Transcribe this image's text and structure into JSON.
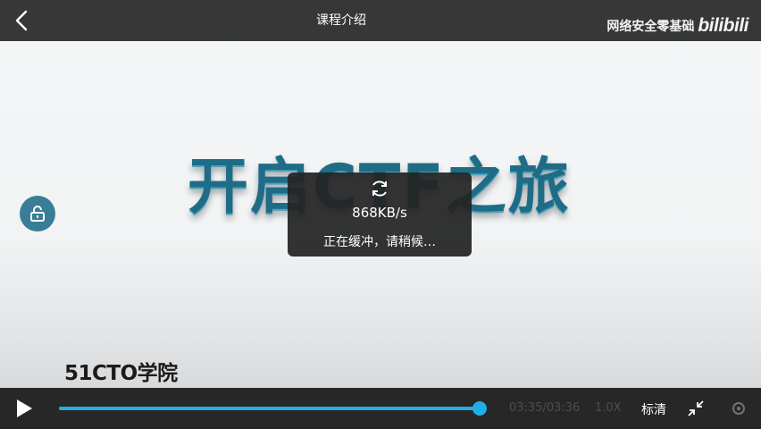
{
  "header": {
    "title": "课程介绍",
    "back_icon": "chevron-left-icon"
  },
  "watermark": {
    "uploader": "网络安全零基础",
    "logo_text": "bilibili"
  },
  "slide": {
    "title": "开启CTF之旅",
    "footer_logo": "51CTO学院"
  },
  "lock": {
    "icon": "unlock-icon"
  },
  "buffering": {
    "icon": "refresh-icon",
    "speed": "868KB/s",
    "message": "正在缓冲，请稍候…"
  },
  "controls": {
    "play_icon": "play-icon",
    "time": "03:35/03:36",
    "speed": "1.0X",
    "quality": "标清",
    "exit_fullscreen_icon": "collapse-arrows-icon",
    "settings_icon": "settings-icon"
  },
  "playback": {
    "progress": 0.99
  },
  "colors": {
    "accent": "#23ade5",
    "bar_background": "#262626",
    "slide_text": "#1f6c86",
    "lock_button": "#3a7d96"
  }
}
